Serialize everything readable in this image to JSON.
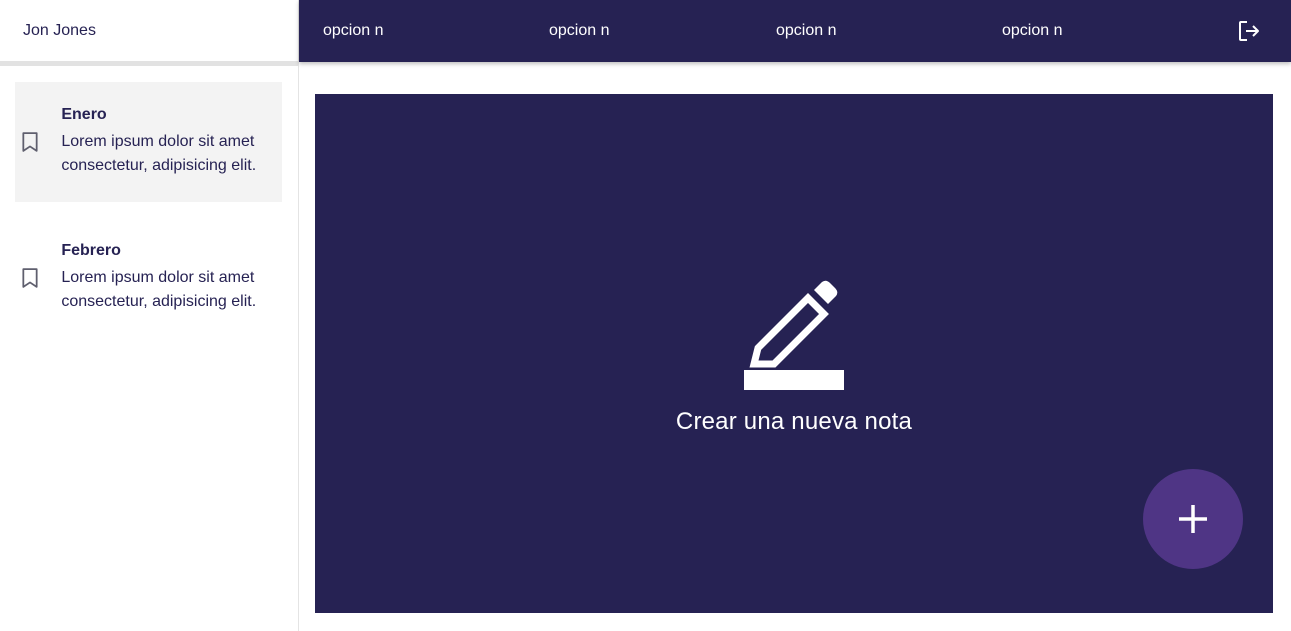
{
  "sidebar": {
    "user_name": "Jon Jones",
    "entries": [
      {
        "title": "Enero",
        "text": "Lorem ipsum dolor sit amet consectetur, adipisicing elit.",
        "icon": "bookmark-icon"
      },
      {
        "title": "Febrero",
        "text": "Lorem ipsum dolor sit amet consectetur, adipisicing elit.",
        "icon": "bookmark-icon"
      }
    ]
  },
  "navbar": {
    "items": [
      {
        "label": "opcion n"
      },
      {
        "label": "opcion n"
      },
      {
        "label": "opcion n"
      },
      {
        "label": "opcion n"
      }
    ],
    "logout_icon": "logout-icon"
  },
  "main": {
    "empty_icon": "pencil-icon",
    "empty_label": "Crear una nueva nota"
  },
  "fab": {
    "icon": "plus-icon"
  },
  "colors": {
    "primary": "#262253",
    "fab": "#4f3585",
    "active_entry_bg": "#f3f3f3",
    "white": "#ffffff"
  }
}
